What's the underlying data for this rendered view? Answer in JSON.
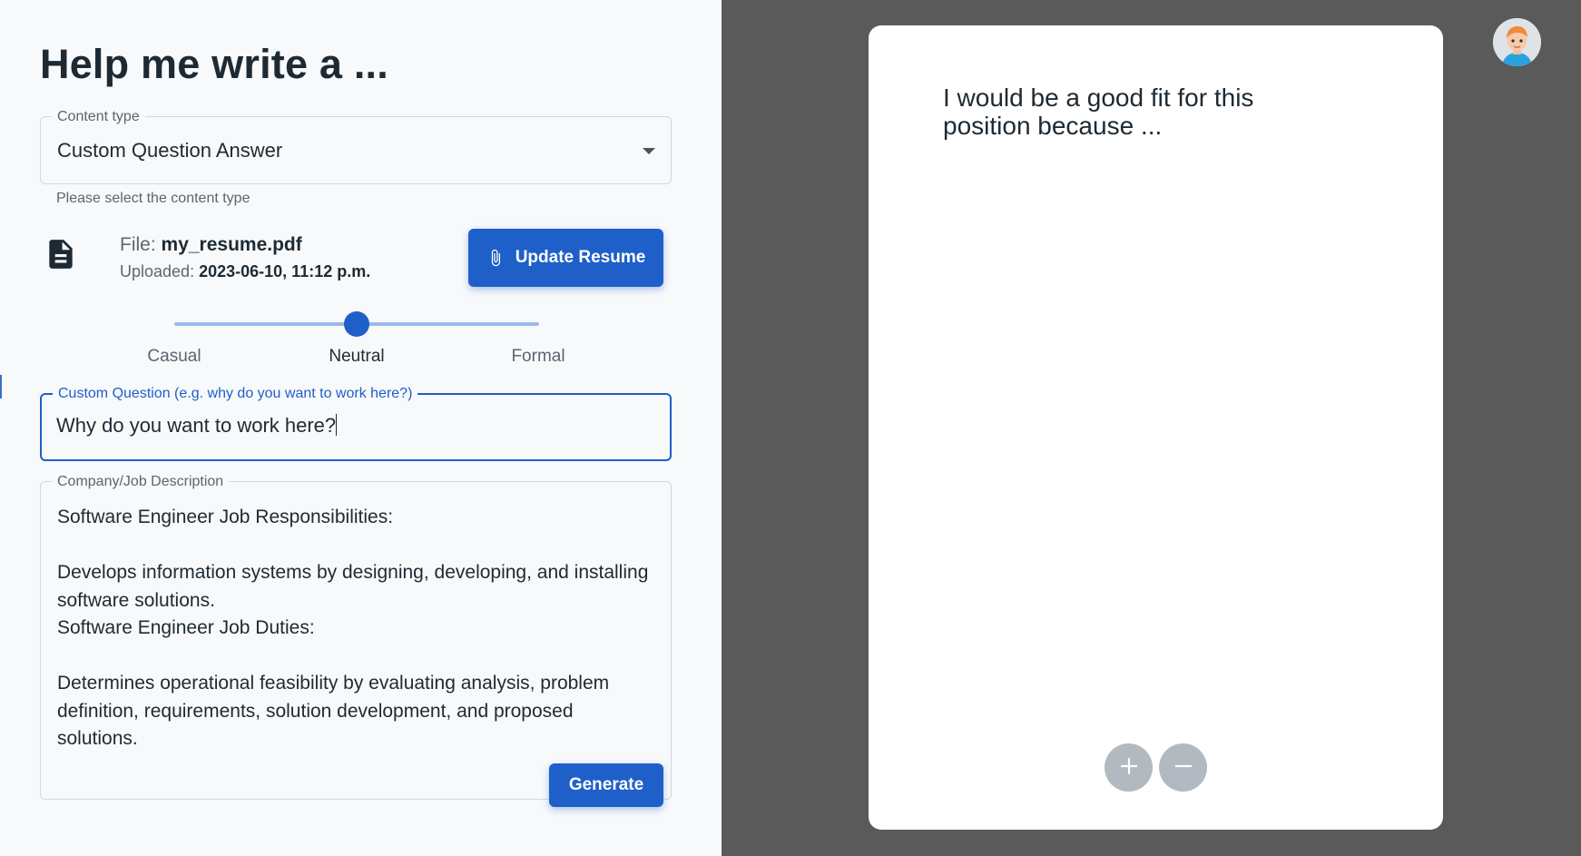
{
  "page": {
    "title": "Help me write a ..."
  },
  "content_type": {
    "label": "Content type",
    "value": "Custom Question Answer",
    "helper": "Please select the content type"
  },
  "file": {
    "name_key": "File:",
    "name_value": "my_resume.pdf",
    "uploaded_key": "Uploaded:",
    "uploaded_value": "2023-06-10, 11:12 p.m.",
    "icon": "file-document-icon"
  },
  "update_resume": {
    "label": "Update Resume",
    "icon": "paperclip-icon"
  },
  "tone_slider": {
    "marks": [
      "Casual",
      "Neutral",
      "Formal"
    ],
    "selected": "Neutral",
    "value_fraction": 0.5
  },
  "custom_question": {
    "label": "Custom Question (e.g. why do you want to work here?)",
    "value": "Why do you want to work here?"
  },
  "job_description": {
    "label": "Company/Job Description",
    "value": "Software Engineer Job Responsibilities:\n\nDevelops information systems by designing, developing, and installing software solutions.\nSoftware Engineer Job Duties:\n\nDetermines operational feasibility by evaluating analysis, problem definition, requirements, solution development, and proposed solutions."
  },
  "generate": {
    "label": "Generate"
  },
  "preview": {
    "text": "I would be a good fit for this position because ..."
  },
  "zoom": {
    "in_icon": "plus-icon",
    "out_icon": "minus-icon"
  },
  "colors": {
    "primary": "#1f5fc9",
    "left_bg": "#f7f9fb",
    "right_bg": "#5a5a5a",
    "text": "#1e2a33"
  }
}
